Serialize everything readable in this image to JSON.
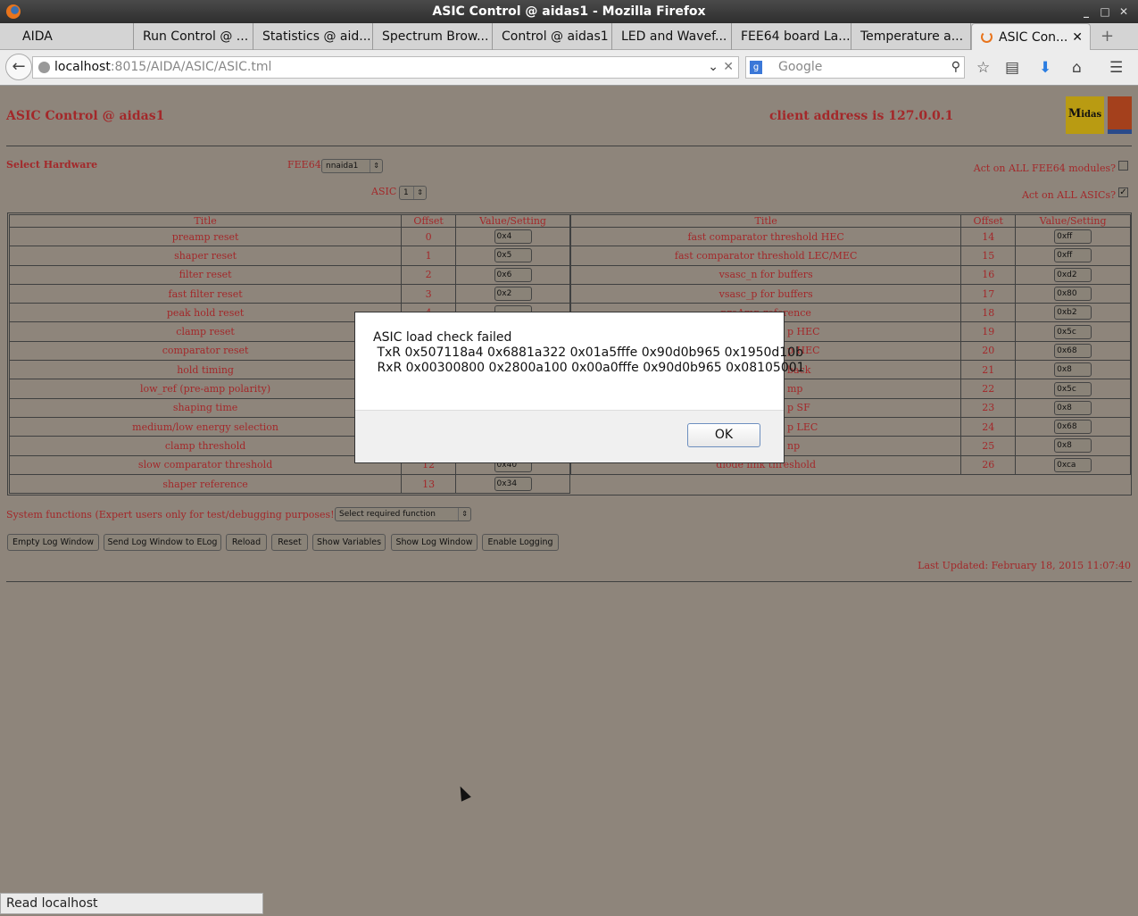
{
  "window": {
    "title": "ASIC Control @ aidas1 - Mozilla Firefox"
  },
  "tabs": [
    "AIDA",
    "Run Control @ ...",
    "Statistics @ aid...",
    "Spectrum Brow...",
    "Control @ aidas1",
    "LED and Wavef...",
    "FEE64 board La...",
    "Temperature a...",
    "ASIC Con..."
  ],
  "navbar": {
    "url_host": "localhost",
    "url_rest": ":8015/AIDA/ASIC/ASIC.tml",
    "search_placeholder": "Google"
  },
  "page": {
    "title": "ASIC Control @ aidas1",
    "client": "client address is 127.0.0.1",
    "select_hw": "Select Hardware",
    "fee64_label": "FEE64",
    "fee64_value": "nnaida1",
    "asic_label": "ASIC",
    "asic_value": "1",
    "act_all_fee": "Act on ALL FEE64 modules?",
    "act_all_fee_checked": false,
    "act_all_asics": "Act on ALL ASICs?",
    "act_all_asics_checked": true,
    "columns": [
      "Title",
      "Offset",
      "Value/Setting"
    ],
    "left_rows": [
      {
        "title": "preamp reset",
        "offset": "0",
        "value": "0x4"
      },
      {
        "title": "shaper reset",
        "offset": "1",
        "value": "0x5"
      },
      {
        "title": "filter reset",
        "offset": "2",
        "value": "0x6"
      },
      {
        "title": "fast filter reset",
        "offset": "3",
        "value": "0x2"
      },
      {
        "title": "peak hold reset",
        "offset": "4",
        "value": ""
      },
      {
        "title": "clamp reset",
        "offset": "",
        "value": ""
      },
      {
        "title": "comparator reset",
        "offset": "",
        "value": ""
      },
      {
        "title": "hold timing",
        "offset": "",
        "value": ""
      },
      {
        "title": "low_ref (pre-amp polarity)",
        "offset": "",
        "value": ""
      },
      {
        "title": "shaping time",
        "offset": "",
        "value": ""
      },
      {
        "title": "medium/low energy selection",
        "offset": "",
        "value": ""
      },
      {
        "title": "clamp threshold",
        "offset": "",
        "value": ""
      },
      {
        "title": "slow comparator threshold",
        "offset": "12",
        "value": "0x40"
      },
      {
        "title": "shaper reference",
        "offset": "13",
        "value": "0x34"
      }
    ],
    "right_rows": [
      {
        "title": "fast comparator threshold HEC",
        "offset": "14",
        "value": "0xff"
      },
      {
        "title": "fast comparator threshold LEC/MEC",
        "offset": "15",
        "value": "0xff"
      },
      {
        "title": "vsasc_n for buffers",
        "offset": "16",
        "value": "0xd2"
      },
      {
        "title": "vsasc_p for buffers",
        "offset": "17",
        "value": "0x80"
      },
      {
        "title": "preAmp reference",
        "offset": "18",
        "value": "0xb2"
      },
      {
        "title": "p HEC",
        "offset": "19",
        "value": "0x5c",
        "partial": true
      },
      {
        "title": "p HEC",
        "offset": "20",
        "value": "0x68",
        "partial": true
      },
      {
        "title": "back",
        "offset": "21",
        "value": "0x8",
        "partial": true
      },
      {
        "title": "mp",
        "offset": "22",
        "value": "0x5c",
        "partial": true
      },
      {
        "title": "p SF",
        "offset": "23",
        "value": "0x8",
        "partial": true
      },
      {
        "title": "p LEC",
        "offset": "24",
        "value": "0x68",
        "partial": true
      },
      {
        "title": "np",
        "offset": "25",
        "value": "0x8",
        "partial": true
      },
      {
        "title": "diode link threshold",
        "offset": "26",
        "value": "0xca"
      }
    ],
    "sys_label": "System functions (Expert users only for test/debugging purposes!!!)",
    "sys_select": "Select required function",
    "buttons": [
      "Empty Log Window",
      "Send Log Window to ELog",
      "Reload",
      "Reset",
      "Show Variables",
      "Show Log Window",
      "Enable Logging"
    ],
    "last_updated": "Last Updated: February 18, 2015 11:07:40",
    "logo_text": "Midas"
  },
  "dialog": {
    "line1": "ASIC load check failed",
    "line2": " TxR 0x507118a4 0x6881a322 0x01a5fffe 0x90d0b965 0x1950d10b",
    "line3": " RxR 0x00300800 0x2800a100 0x00a0fffe 0x90d0b965 0x08105001",
    "ok": "OK"
  },
  "status": "Read localhost"
}
